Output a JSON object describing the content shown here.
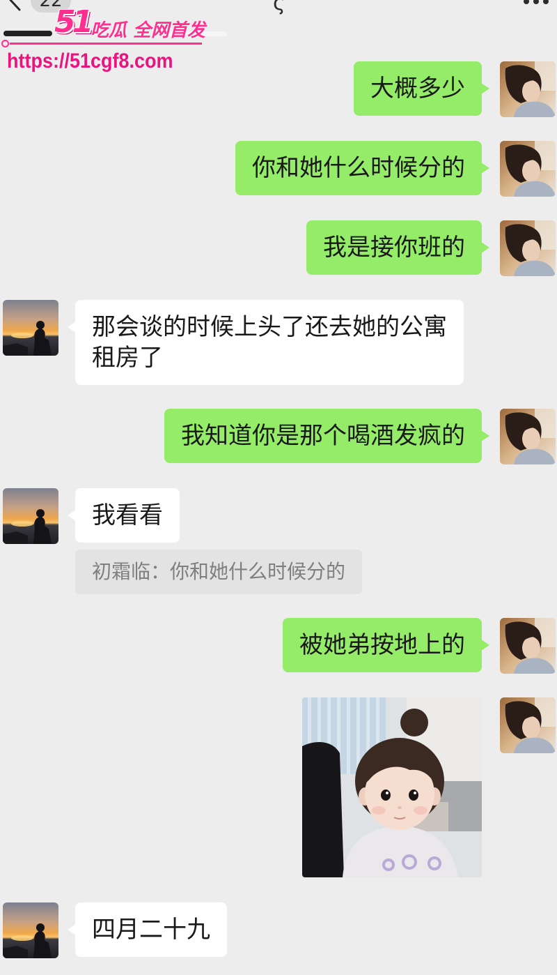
{
  "top_bar": {
    "back_icon": "chevron-left-icon",
    "unread_count": "22",
    "title_fragment": "ς",
    "more_icon": "more-dots-icon"
  },
  "watermark": {
    "brand_number": "51",
    "brand_text": "吃瓜 全网首发",
    "url": "https://51cgf8.com"
  },
  "avatars": {
    "self": "self-portrait-avatar",
    "contact": "sunset-silhouette-avatar"
  },
  "colors": {
    "background": "#ededed",
    "sent_bubble": "#95ec69",
    "received_bubble": "#ffffff",
    "quote_background": "#e3e3e3",
    "quote_text": "#7f7f7f",
    "message_text": "#191919",
    "watermark": "#ff2e8f",
    "watermark_url": "#e8157f"
  },
  "messages": [
    {
      "text": "大概多少"
    },
    {
      "text": "你和她什么时候分的"
    },
    {
      "text": "我是接你班的"
    },
    {
      "text": "那会谈的时候上头了还去她的公寓租房了"
    },
    {
      "text": "我知道你是那个喝酒发疯的"
    },
    {
      "text": "我看看",
      "quote": "初霜临：你和她什么时候分的"
    },
    {
      "text": "被她弟按地上的"
    },
    {
      "image": "child-photo-image"
    },
    {
      "text": "四月二十九"
    }
  ]
}
